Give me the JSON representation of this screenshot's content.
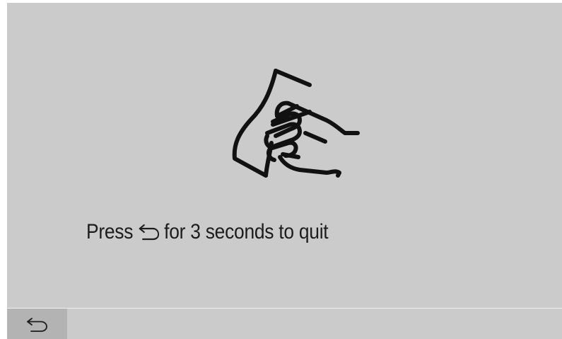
{
  "screen": {
    "background_color": "#cbcbcb",
    "text_color": "#1c1c1c"
  },
  "main": {
    "icon": "hand-touch-icon",
    "message": {
      "before": "Press",
      "inline_icon": "back-arrow-icon",
      "after": "for 3 seconds to quit"
    }
  },
  "bottom_bar": {
    "back_button": {
      "icon": "back-arrow-icon",
      "background_color": "#b3b3b3"
    }
  }
}
